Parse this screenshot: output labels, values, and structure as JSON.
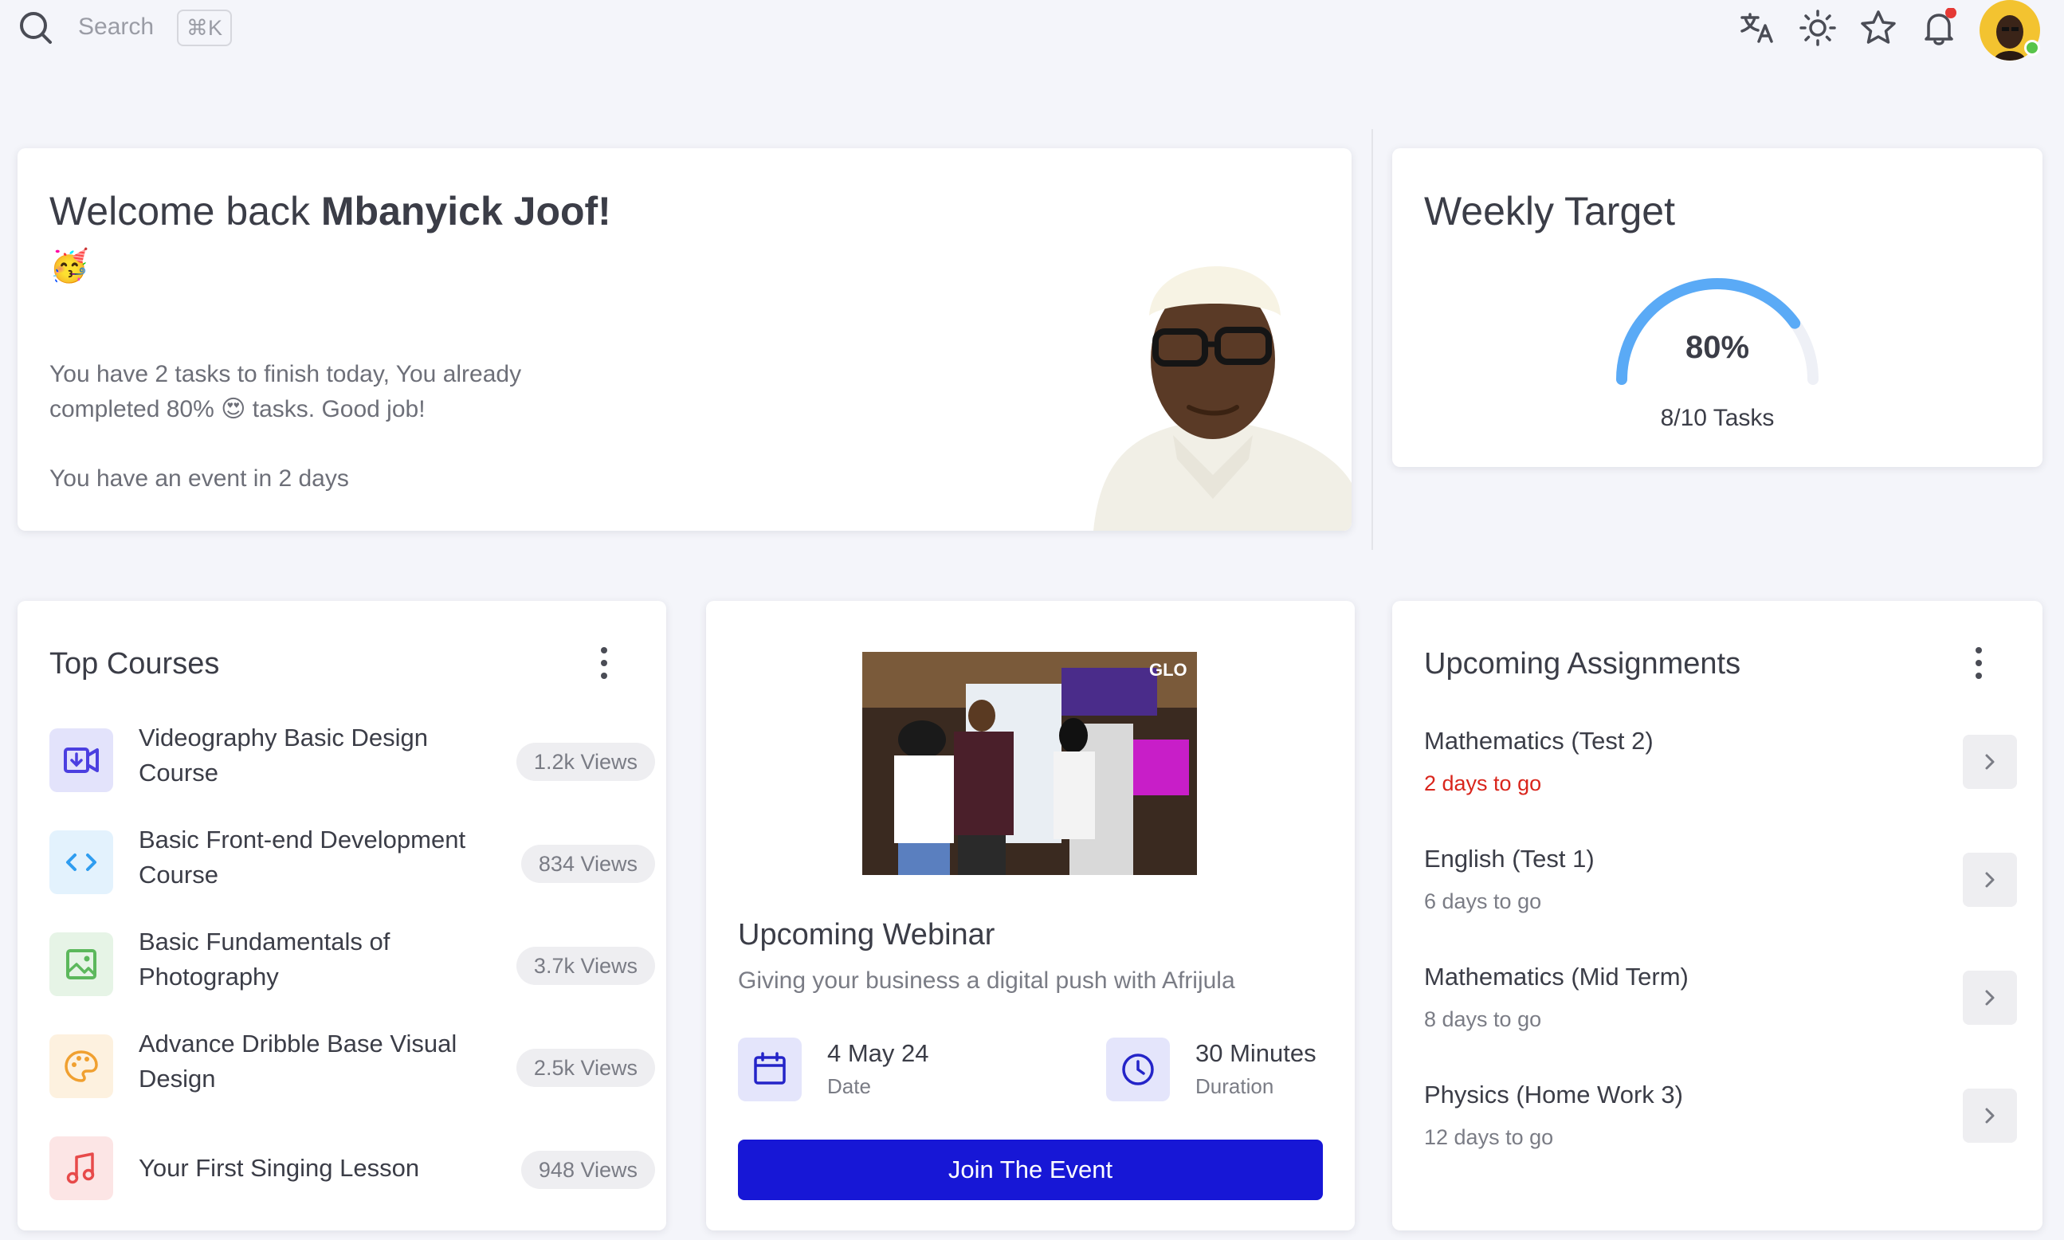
{
  "topbar": {
    "search_placeholder": "Search",
    "shortcut": "⌘K",
    "icons": [
      "translate-icon",
      "sun-icon",
      "star-icon",
      "bell-icon"
    ],
    "notification_dot_color": "#e53935"
  },
  "welcome": {
    "greeting": "Welcome back",
    "name": "Mbanyick Joof!",
    "emoji": "🥳",
    "message_part1": "You have 2 tasks to finish today, You already completed 80%",
    "message_emoji": "😍",
    "message_part2": "tasks. Good job!",
    "event_message": "You have an event in 2 days"
  },
  "weekly_target": {
    "title": "Weekly Target",
    "percent_label": "80%",
    "progress": 0.8,
    "tasks_label": "8/10 Tasks",
    "color": "#5aaaf6"
  },
  "top_courses": {
    "title": "Top Courses",
    "items": [
      {
        "name": "Videography Basic Design Course",
        "views": "1.2k Views",
        "icon": "video-icon",
        "color": "#4b3fe0",
        "bg": "#e3e3fb"
      },
      {
        "name": "Basic Front-end Development Course",
        "views": "834 Views",
        "icon": "code-icon",
        "color": "#2f9df0",
        "bg": "#e3f2fd"
      },
      {
        "name": "Basic Fundamentals of Photography",
        "views": "3.7k Views",
        "icon": "image-icon",
        "color": "#5cb85c",
        "bg": "#e6f4e6"
      },
      {
        "name": "Advance Dribble Base Visual Design",
        "views": "2.5k Views",
        "icon": "palette-icon",
        "color": "#f0a030",
        "bg": "#fdf1df"
      },
      {
        "name": "Your First Singing Lesson",
        "views": "948 Views",
        "icon": "music-icon",
        "color": "#e74a4a",
        "bg": "#fce5e5"
      }
    ]
  },
  "webinar": {
    "title": "Upcoming Webinar",
    "subtitle": "Giving your business a digital push with Afrijula",
    "date_value": "4 May 24",
    "date_label": "Date",
    "duration_value": "30 Minutes",
    "duration_label": "Duration",
    "button": "Join The Event",
    "photo_text": "GLO"
  },
  "assignments": {
    "title": "Upcoming Assignments",
    "items": [
      {
        "name": "Mathematics (Test 2)",
        "due": "2 days to go",
        "urgent": true
      },
      {
        "name": "English (Test 1)",
        "due": "6 days to go",
        "urgent": false
      },
      {
        "name": "Mathematics (Mid Term)",
        "due": "8 days to go",
        "urgent": false
      },
      {
        "name": "Physics (Home Work 3)",
        "due": "12 days to go",
        "urgent": false
      }
    ]
  }
}
